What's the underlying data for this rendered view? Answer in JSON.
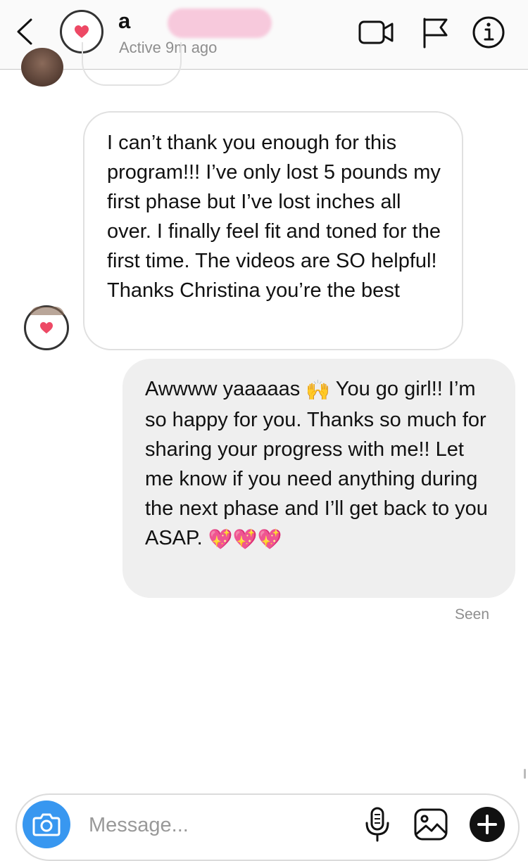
{
  "header": {
    "username_visible": "a",
    "status": "Active 9m ago",
    "icons": [
      "back-icon",
      "heart-icon",
      "video-camera-icon",
      "flag-icon",
      "info-icon"
    ]
  },
  "messages": [
    {
      "direction": "incoming",
      "text": "I can’t thank you enough for this program!!!  I’ve only lost 5 pounds my first phase but I’ve lost inches all over.  I finally feel fit and toned for the first time. The videos are SO helpful! Thanks Christina you’re the best"
    },
    {
      "direction": "outgoing",
      "text_part1": "Awwww yaaaaas ",
      "emoji_hands": "🙌",
      "text_part2": " You go girl!! I’m so happy for you.  Thanks so much for sharing your progress with me!!  Let me know if you need anything during the next phase and I’ll get back to you ASAP. ",
      "emoji_hearts": [
        "💖",
        "💖",
        "💖"
      ]
    }
  ],
  "seen_label": "Seen",
  "composer": {
    "placeholder": "Message...",
    "icons": [
      "camera-icon",
      "microphone-icon",
      "gallery-icon",
      "plus-icon"
    ]
  },
  "colors": {
    "accent_blue": "#3897f0",
    "heart_pink": "#ed4965",
    "outgoing_bubble": "#efefef",
    "muted_text": "#8e8e8e"
  }
}
